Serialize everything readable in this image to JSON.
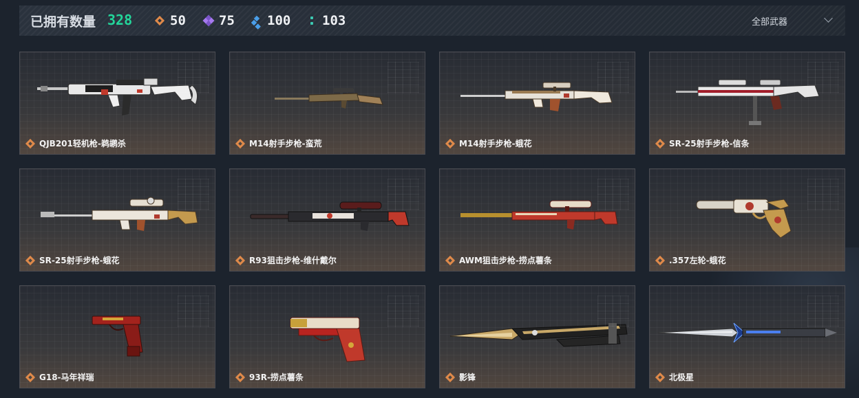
{
  "header": {
    "owned_label": "已拥有数量",
    "owned_count": "328",
    "stats": [
      {
        "icon": "orange-rarity-icon",
        "value": "50",
        "color": "#e08a4a"
      },
      {
        "icon": "purple-rarity-icon",
        "value": "75",
        "color": "#a77af0"
      },
      {
        "icon": "blue-rarity-icon",
        "value": "100",
        "color": "#4a9ee8"
      },
      {
        "icon": "teal-rarity-icon",
        "value": "103",
        "color": "#3cc9b2"
      }
    ],
    "filter": {
      "label": "全部武器",
      "icon": "chevron-down-icon"
    }
  },
  "items": [
    {
      "name": "QJB201轻机枪-鹈鹕杀"
    },
    {
      "name": "M14射手步枪-蛮荒"
    },
    {
      "name": "M14射手步枪-蛾花"
    },
    {
      "name": "SR-25射手步枪-信条"
    },
    {
      "name": "SR-25射手步枪-蛾花"
    },
    {
      "name": "R93狙击步枪-维什戴尔"
    },
    {
      "name": "AWM狙击步枪-捞点薯条"
    },
    {
      "name": ".357左轮-蛾花"
    },
    {
      "name": "G18-马年祥瑞"
    },
    {
      "name": "93R-捞点薯条"
    },
    {
      "name": "影锋"
    },
    {
      "name": "北极星"
    }
  ],
  "colors": {
    "accent_green": "#23d59a",
    "rarity_orange": "#e08a4a"
  }
}
